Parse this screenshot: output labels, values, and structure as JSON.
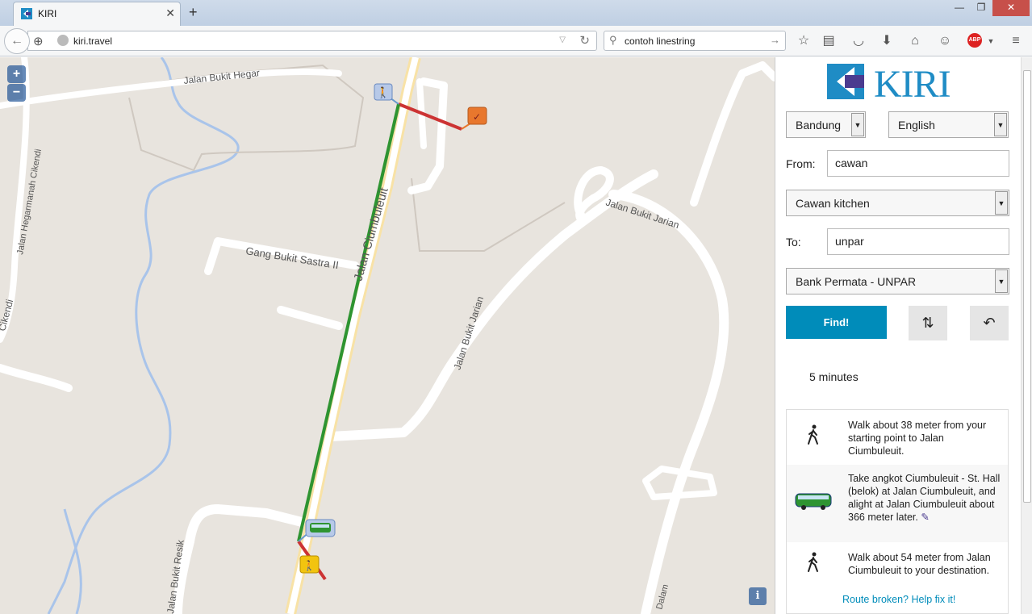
{
  "browser": {
    "tab_title": "KIRI",
    "url": "kiri.travel",
    "search_value": "contoh linestring",
    "window_min": "—",
    "window_max": "❐",
    "window_close": "✕"
  },
  "map": {
    "zoom_in": "+",
    "zoom_out": "−",
    "info": "i",
    "streets": [
      "Jalan Bukit Hegar",
      "Jalan Hegarmanah Cikendi",
      "Gang Bukit Sastra II",
      "Jalan Ciumbuleuit",
      "Jalan Bukit Jarian",
      "Jalan Bukit Jarian",
      "Jalan Bukit Resik",
      "Cikendi",
      "Dalam"
    ]
  },
  "sidebar": {
    "logo_text": "KIRI",
    "city": "Bandung",
    "language": "English",
    "from_label": "From:",
    "from_value": "cawan",
    "from_select": "Cawan kitchen",
    "to_label": "To:",
    "to_value": "unpar",
    "to_select": "Bank Permata - UNPAR",
    "find_label": "Find!",
    "swap_icon": "⇅",
    "reset_icon": "↶",
    "duration": "5 minutes",
    "steps": [
      {
        "icon": "walk-icon",
        "text": "Walk about 38 meter from your starting point to Jalan Ciumbuleuit."
      },
      {
        "icon": "angkot-icon",
        "text": "Take angkot Ciumbuleuit - St. Hall (belok) at Jalan Ciumbuleuit, and alight at Jalan Ciumbuleuit about 366 meter later."
      },
      {
        "icon": "walk-icon",
        "text": "Walk about 54 meter from Jalan Ciumbuleuit to your destination."
      }
    ],
    "help_link": "Route broken? Help fix it!"
  },
  "colors": {
    "accent": "#008cba",
    "walk_route": "#cc3333",
    "angkot_route": "#2e9431",
    "logo_blue": "#1f8cc5",
    "logo_purple": "#4a3b8f"
  }
}
